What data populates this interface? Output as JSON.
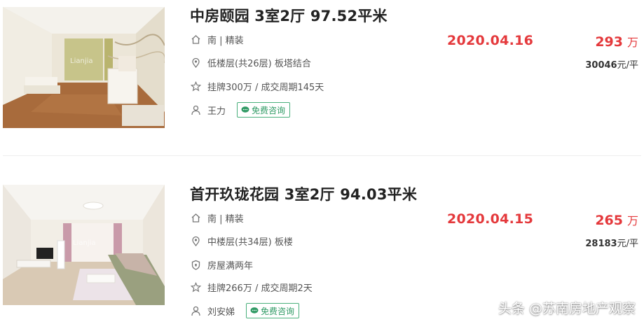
{
  "listings": [
    {
      "title": "中房颐园 3室2厅 97.52平米",
      "orientation": "南 | 精装",
      "floor": "低楼层(共26层) 板塔结合",
      "tag": "",
      "deal": "挂牌300万 / 成交周期145天",
      "agent": "王力",
      "consult_label": "免费咨询",
      "date": "2020.04.16",
      "price": "293",
      "price_unit": "万",
      "unit_price_num": "30046",
      "unit_price_unit": "元/平"
    },
    {
      "title": "首开玖珑花园 3室2厅 94.03平米",
      "orientation": "南 | 精装",
      "floor": "中楼层(共34层) 板楼",
      "tag": "房屋满两年",
      "deal": "挂牌266万 / 成交周期2天",
      "agent": "刘安娣",
      "consult_label": "免费咨询",
      "date": "2020.04.15",
      "price": "265",
      "price_unit": "万",
      "unit_price_num": "28183",
      "unit_price_unit": "元/平"
    }
  ],
  "watermark": "头条 @苏南房地产观察",
  "colors": {
    "accent_red": "#e4393c",
    "consult_green": "#2f9a64"
  },
  "icons": [
    "house-icon",
    "location-pin-icon",
    "shield-icon",
    "star-icon",
    "user-icon",
    "chat-bubble-icon"
  ]
}
